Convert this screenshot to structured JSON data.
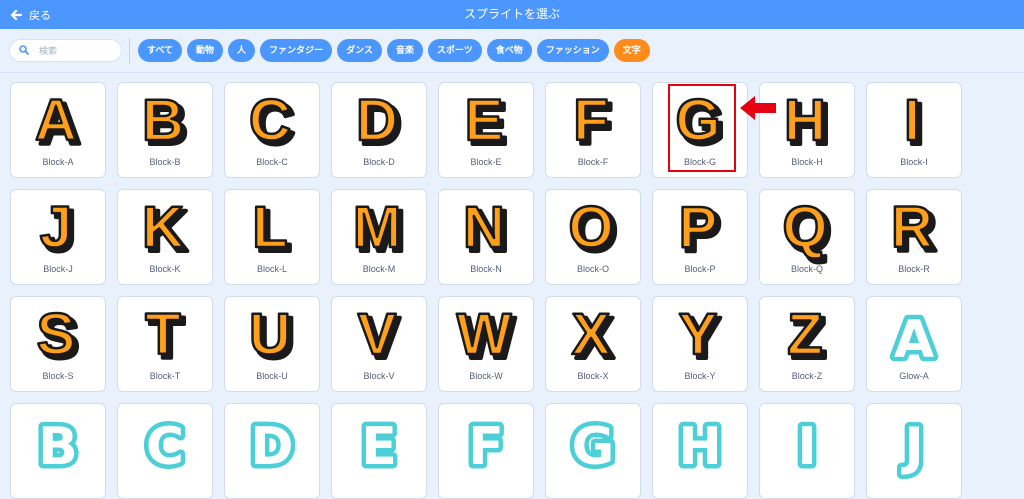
{
  "header": {
    "back_label": "戻る",
    "title": "スプライトを選ぶ"
  },
  "search": {
    "placeholder": "検索"
  },
  "categories": [
    {
      "label": "すべて",
      "active": false
    },
    {
      "label": "動物",
      "active": false
    },
    {
      "label": "人",
      "active": false
    },
    {
      "label": "ファンタジー",
      "active": false
    },
    {
      "label": "ダンス",
      "active": false
    },
    {
      "label": "音楽",
      "active": false
    },
    {
      "label": "スポーツ",
      "active": false
    },
    {
      "label": "食べ物",
      "active": false
    },
    {
      "label": "ファッション",
      "active": false
    },
    {
      "label": "文字",
      "active": true
    }
  ],
  "sprites": [
    {
      "name": "Block-A",
      "glyph": "A",
      "style": "block"
    },
    {
      "name": "Block-B",
      "glyph": "B",
      "style": "block"
    },
    {
      "name": "Block-C",
      "glyph": "C",
      "style": "block"
    },
    {
      "name": "Block-D",
      "glyph": "D",
      "style": "block"
    },
    {
      "name": "Block-E",
      "glyph": "E",
      "style": "block"
    },
    {
      "name": "Block-F",
      "glyph": "F",
      "style": "block"
    },
    {
      "name": "Block-G",
      "glyph": "G",
      "style": "block"
    },
    {
      "name": "Block-H",
      "glyph": "H",
      "style": "block"
    },
    {
      "name": "Block-I",
      "glyph": "I",
      "style": "block"
    },
    {
      "name": "Block-J",
      "glyph": "J",
      "style": "block"
    },
    {
      "name": "Block-K",
      "glyph": "K",
      "style": "block"
    },
    {
      "name": "Block-L",
      "glyph": "L",
      "style": "block"
    },
    {
      "name": "Block-M",
      "glyph": "M",
      "style": "block"
    },
    {
      "name": "Block-N",
      "glyph": "N",
      "style": "block"
    },
    {
      "name": "Block-O",
      "glyph": "O",
      "style": "block"
    },
    {
      "name": "Block-P",
      "glyph": "P",
      "style": "block"
    },
    {
      "name": "Block-Q",
      "glyph": "Q",
      "style": "block"
    },
    {
      "name": "Block-R",
      "glyph": "R",
      "style": "block"
    },
    {
      "name": "Block-S",
      "glyph": "S",
      "style": "block"
    },
    {
      "name": "Block-T",
      "glyph": "T",
      "style": "block"
    },
    {
      "name": "Block-U",
      "glyph": "U",
      "style": "block"
    },
    {
      "name": "Block-V",
      "glyph": "V",
      "style": "block"
    },
    {
      "name": "Block-W",
      "glyph": "W",
      "style": "block"
    },
    {
      "name": "Block-X",
      "glyph": "X",
      "style": "block"
    },
    {
      "name": "Block-Y",
      "glyph": "Y",
      "style": "block"
    },
    {
      "name": "Block-Z",
      "glyph": "Z",
      "style": "block"
    },
    {
      "name": "Glow-A",
      "glyph": "A",
      "style": "glow"
    },
    {
      "name": "",
      "glyph": "B",
      "style": "glow"
    },
    {
      "name": "",
      "glyph": "C",
      "style": "glow"
    },
    {
      "name": "",
      "glyph": "D",
      "style": "glow"
    },
    {
      "name": "",
      "glyph": "E",
      "style": "glow"
    },
    {
      "name": "",
      "glyph": "F",
      "style": "glow"
    },
    {
      "name": "",
      "glyph": "G",
      "style": "glow"
    },
    {
      "name": "",
      "glyph": "H",
      "style": "glow"
    },
    {
      "name": "",
      "glyph": "I",
      "style": "glow"
    },
    {
      "name": "",
      "glyph": "J",
      "style": "glow"
    }
  ],
  "selected_sprite": "Block-G",
  "colors": {
    "header": "#4c97ff",
    "tag": "#4c97ff",
    "tag_active": "#ff8c1a",
    "block_fill": "#ff9f1a",
    "glow_fill": "#4ccfd6",
    "highlight": "#e60012"
  },
  "icons": {
    "back": "arrow-left-icon",
    "search": "search-icon",
    "pointer": "pointer-arrow-icon"
  }
}
